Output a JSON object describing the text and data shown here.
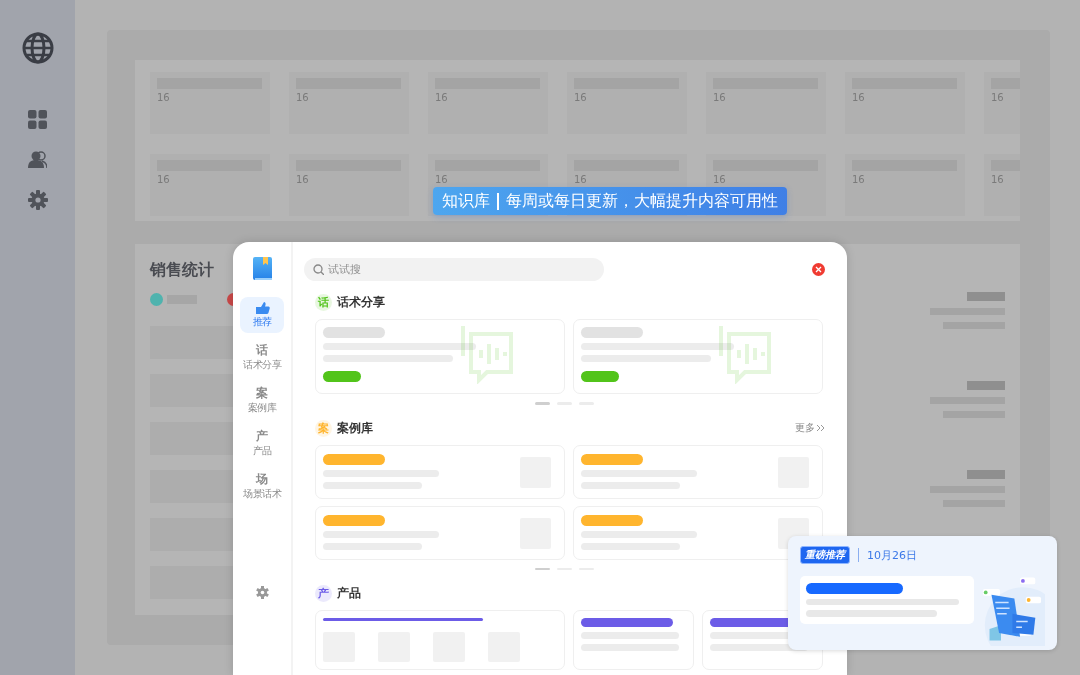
{
  "dashboard": {
    "tiles": [
      {
        "value": "16"
      },
      {
        "value": "16"
      },
      {
        "value": "16"
      },
      {
        "value": "16"
      },
      {
        "value": "16"
      },
      {
        "value": "16"
      },
      {
        "value": "16"
      },
      {
        "value": "16"
      },
      {
        "value": "16"
      },
      {
        "value": "16"
      },
      {
        "value": "16"
      },
      {
        "value": "16"
      },
      {
        "value": "16"
      },
      {
        "value": "16"
      }
    ],
    "sales": {
      "title": "销售统计",
      "legend": [
        {
          "color": "#4fb3ae"
        },
        {
          "color": "#c94848"
        }
      ]
    }
  },
  "banner": {
    "title": "知识库",
    "text": "每周或每日更新，大幅提升内容可用性"
  },
  "modal": {
    "search": {
      "placeholder": "试试搜"
    },
    "nav": [
      {
        "label": "推荐",
        "selected": true
      },
      {
        "glyph": "话",
        "label": "话术分享",
        "selected": false
      },
      {
        "glyph": "案",
        "label": "案例库",
        "selected": false
      },
      {
        "glyph": "产",
        "label": "产品",
        "selected": false
      },
      {
        "glyph": "场",
        "label": "场景话术",
        "selected": false
      }
    ],
    "sections": [
      {
        "kind": "speech",
        "glyph": "话",
        "title": "话术分享",
        "color": "#52c41a",
        "pages": [
          {
            "selected": true
          },
          {
            "selected": false
          },
          {
            "selected": false
          }
        ]
      },
      {
        "kind": "case",
        "glyph": "案",
        "title": "案例库",
        "color": "#ffb52e",
        "more": "更多",
        "pages": [
          {
            "selected": true
          },
          {
            "selected": false
          },
          {
            "selected": false
          }
        ]
      },
      {
        "kind": "product",
        "glyph": "产",
        "title": "产品",
        "color": "#6c5ce7"
      }
    ]
  },
  "promo": {
    "badge": "重磅推荐",
    "date": "10月26日"
  }
}
